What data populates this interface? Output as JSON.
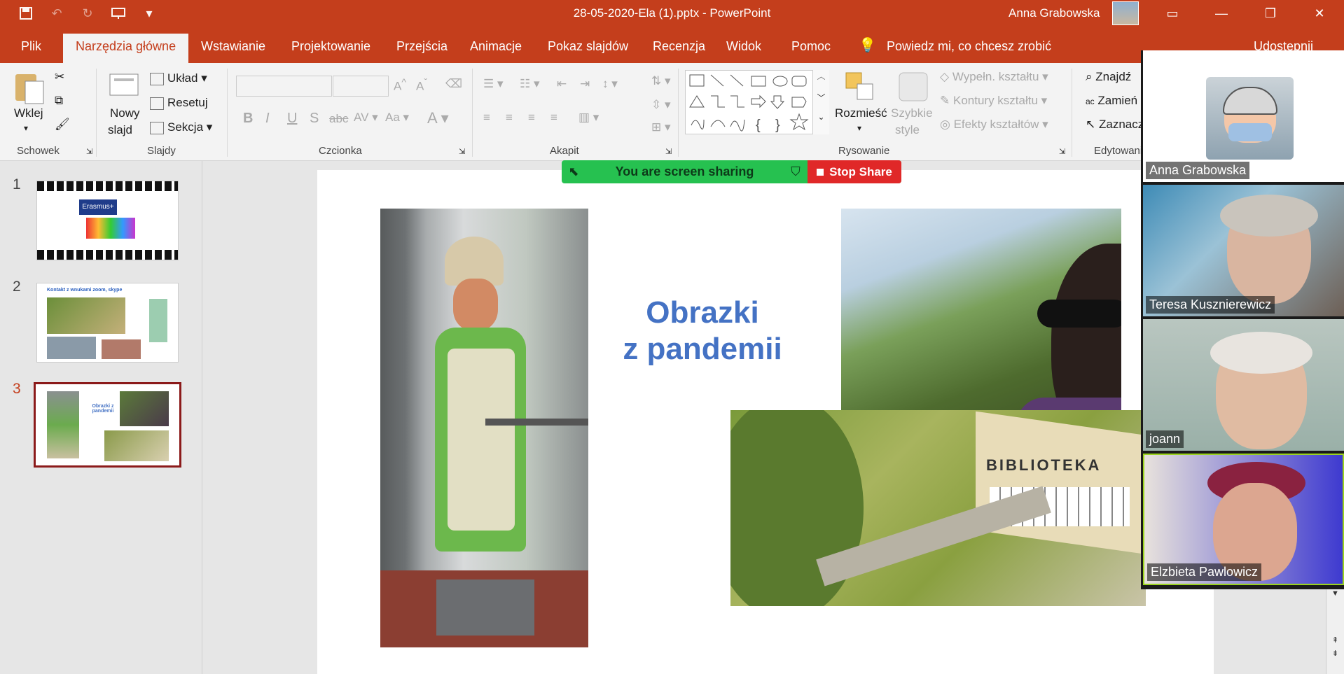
{
  "window": {
    "title": "28-05-2020-Ela (1).pptx  -  PowerPoint",
    "user": "Anna Grabowska"
  },
  "tabs": [
    {
      "label": "Plik"
    },
    {
      "label": "Narzędzia główne"
    },
    {
      "label": "Wstawianie"
    },
    {
      "label": "Projektowanie"
    },
    {
      "label": "Przejścia"
    },
    {
      "label": "Animacje"
    },
    {
      "label": "Pokaz slajdów"
    },
    {
      "label": "Recenzja"
    },
    {
      "label": "Widok"
    },
    {
      "label": "Pomoc"
    }
  ],
  "tell_me": "Powiedz mi, co chcesz zrobić",
  "share": "Udostępnij",
  "ribbon": {
    "clipboard": {
      "paste": "Wklej",
      "label": "Schowek"
    },
    "slides": {
      "new_slide_1": "Nowy",
      "new_slide_2": "slajd",
      "layout": "Układ",
      "reset": "Resetuj",
      "section": "Sekcja",
      "label": "Slajdy"
    },
    "font": {
      "label": "Czcionka"
    },
    "paragraph": {
      "label": "Akapit"
    },
    "drawing": {
      "arrange": "Rozmieść",
      "quick_styles_1": "Szybkie",
      "quick_styles_2": "style",
      "fill": "Wypełn. kształtu",
      "outline": "Kontury kształtu",
      "effects": "Efekty kształtów",
      "label": "Rysowanie"
    },
    "editing": {
      "find": "Znajdź",
      "replace": "Zamień",
      "select": "Zaznacz",
      "label": "Edytowanie"
    }
  },
  "slides": [
    {
      "num": "1",
      "thumb_text": "Erasmus+"
    },
    {
      "num": "2",
      "thumb_text": "Kontakt z wnukami   zoom,  skype"
    },
    {
      "num": "3",
      "thumb_text": "Obrazki z pandemii"
    }
  ],
  "slide": {
    "title_line1": "Obrazki",
    "title_line2": "z pandemii",
    "photo_sign": "BIBLIOTEKA"
  },
  "screen_share": {
    "status": "You are screen sharing",
    "stop": "Stop Share"
  },
  "participants": [
    {
      "name": "Anna Grabowska"
    },
    {
      "name": "Teresa Kusznierewicz"
    },
    {
      "name": "joann"
    },
    {
      "name": "Elzbieta Pawlowicz"
    }
  ]
}
